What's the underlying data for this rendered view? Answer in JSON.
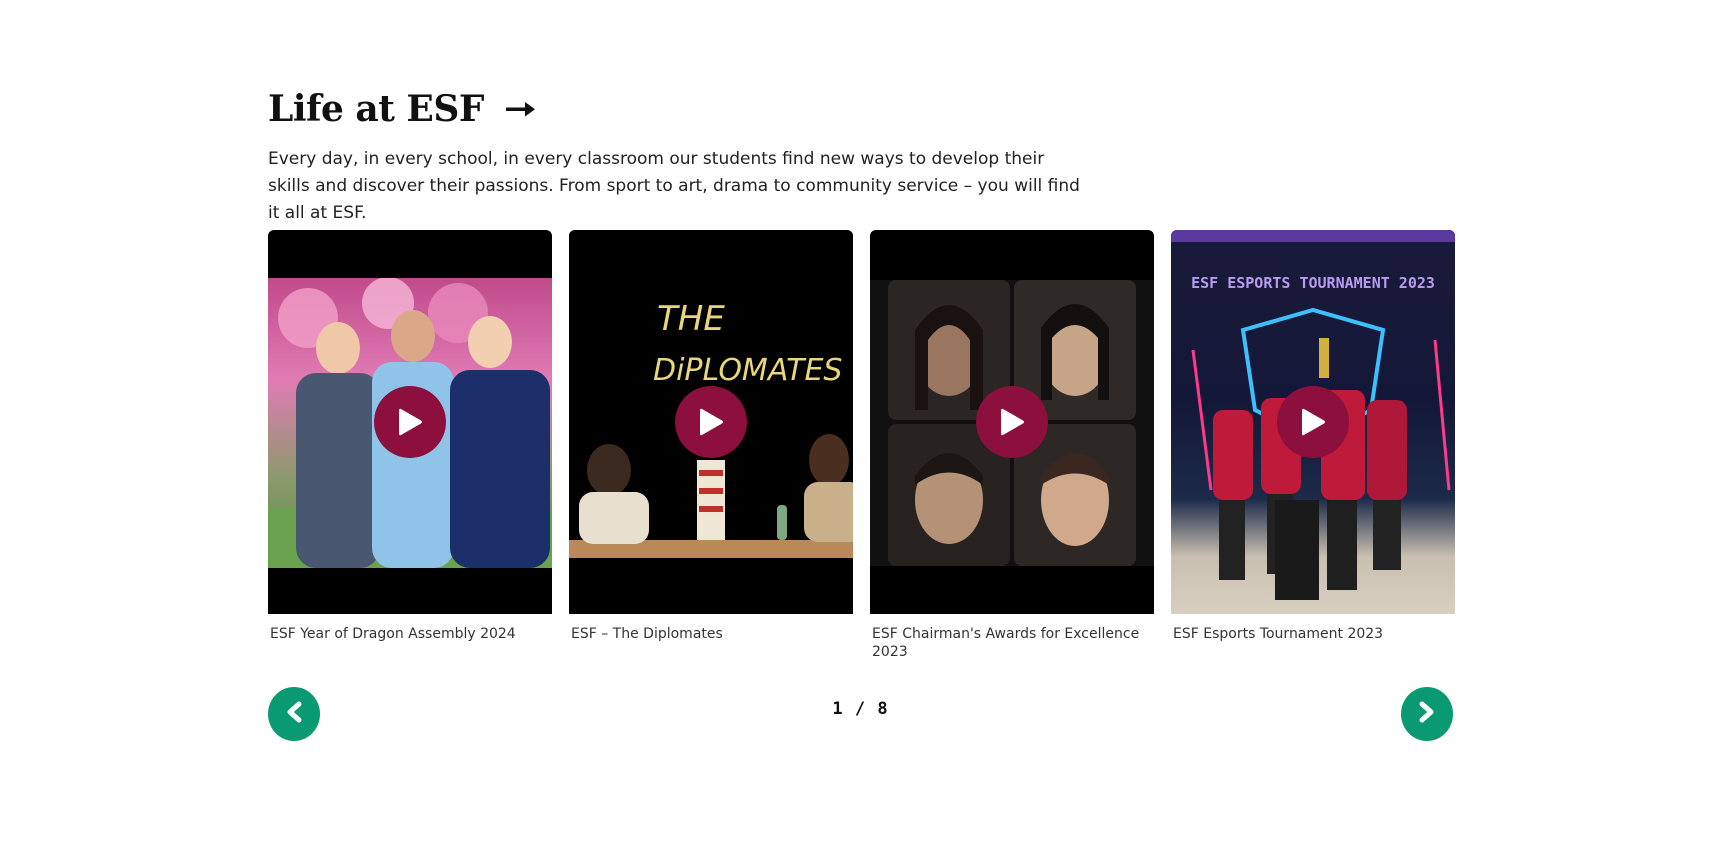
{
  "section": {
    "title": "Life at ESF",
    "arrow_icon": "arrow-right-icon",
    "intro": "Every day, in every school, in every classroom our students find new ways to develop their skills and discover their passions. From sport to art, drama to community service – you will find it all at ESF."
  },
  "cards": [
    {
      "caption": "ESF Year of Dragon Assembly 2024",
      "icon": "play-icon"
    },
    {
      "caption": "ESF – The Diplomates",
      "overlay_text": [
        "THE",
        "DiPLOMATES"
      ],
      "icon": "play-icon"
    },
    {
      "caption": "ESF Chairman's Awards for Excellence 2023",
      "icon": "play-icon"
    },
    {
      "caption": "ESF Esports Tournament 2023",
      "overlay_text": "ESF ESPORTS TOURNAMENT 2023",
      "icon": "play-icon"
    }
  ],
  "pagination": {
    "current": "1",
    "separator": "/",
    "total": "8",
    "prev_icon": "chevron-left-icon",
    "next_icon": "chevron-right-icon"
  },
  "colors": {
    "play_button": "#8c0f3d",
    "nav_button": "#0a9a72",
    "heading": "#111111",
    "text": "#222222"
  }
}
